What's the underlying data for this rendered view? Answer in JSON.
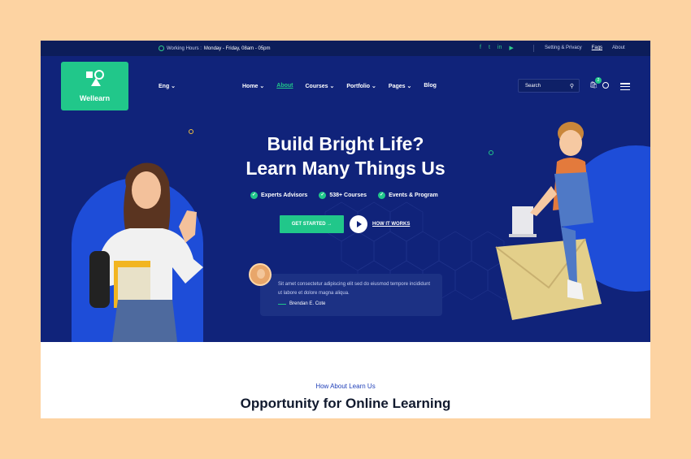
{
  "topbar": {
    "hours_label": "Working Hours :",
    "hours_value": "Monday - Friday, 08am - 05pm",
    "links": [
      "Setting & Privacy",
      "Faqs",
      "About"
    ]
  },
  "brand": {
    "name": "Wellearn",
    "color": "#21c78a"
  },
  "nav": {
    "language": "Eng",
    "items": [
      "Home",
      "About",
      "Courses",
      "Portfolio",
      "Pages",
      "Blog"
    ],
    "search_placeholder": "Search",
    "cart_count": "2"
  },
  "hero": {
    "title_line1": "Build Bright Life?",
    "title_line2": "Learn Many Things Us",
    "features": [
      "Experts Advisors",
      "538+ Courses",
      "Events & Program"
    ],
    "cta_label": "GET STARTED",
    "secondary_label": "HOW IT WORKS",
    "testimonial": {
      "text": "Sit amet consectetur adipiscing elit sed do eiusmod tempore incididunt ut labore et dolore magna aliqua.",
      "author": "Brendan E. Cote"
    }
  },
  "section2": {
    "subtitle": "How About Learn Us",
    "title": "Opportunity for Online Learning"
  },
  "colors": {
    "navy": "#10237a",
    "blue_shape": "#1e4dd8",
    "background": "#fdd3a2"
  }
}
